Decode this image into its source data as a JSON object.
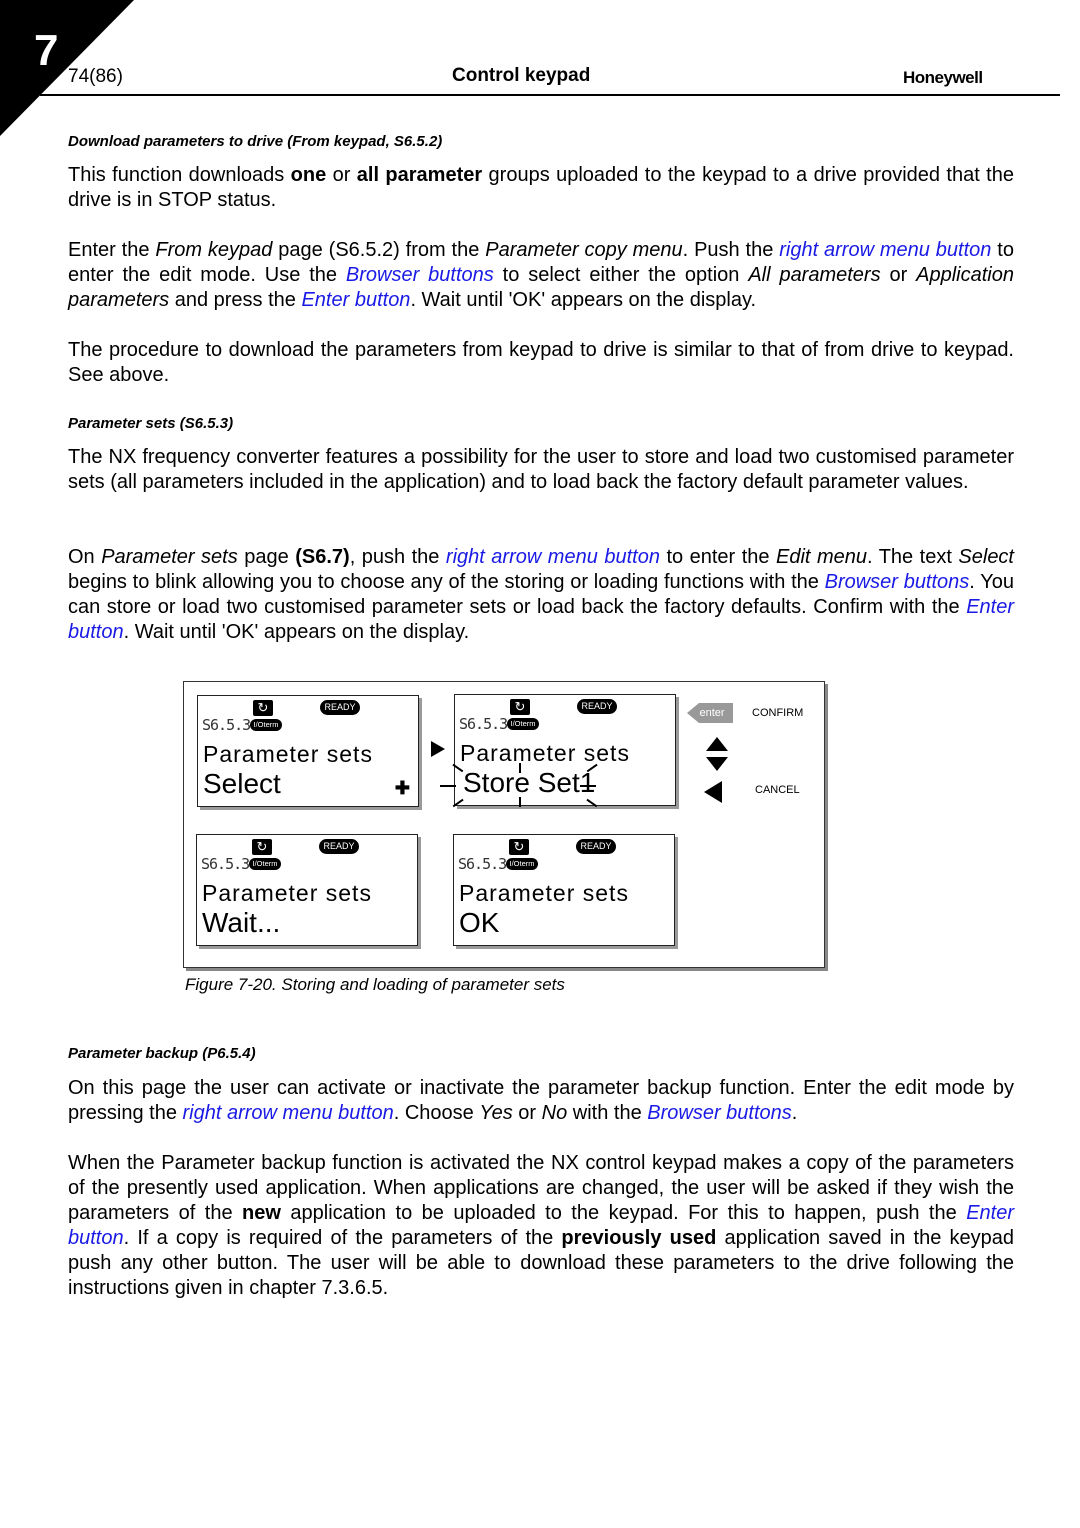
{
  "header": {
    "chapter_number": "7",
    "page_number": "74(86)",
    "title": "Control keypad",
    "brand": "Honeywell"
  },
  "sections": {
    "download": {
      "heading": "Download parameters to drive (From keypad, S6.5.2)",
      "p1": {
        "t1": "This function downloads ",
        "b1": "one",
        "t2": " or ",
        "b2": "all parameter",
        "t3": " groups uploaded to the keypad to a drive provided that the drive is in STOP status."
      },
      "p2": {
        "t1": "Enter the ",
        "i1": "From keypad",
        "t2": " page (S6.5.2) from the ",
        "i2": "Parameter copy menu",
        "t3": ". Push the ",
        "l1": "right arrow menu button",
        "t4": " to enter the edit mode. Use the ",
        "l2": "Browser buttons",
        "t5": " to select either the option ",
        "i3": "All parameters",
        "t6": " or ",
        "i4": "Application parameters",
        "t7": " and press the ",
        "l3": "Enter button",
        "t8": ". Wait until 'OK' appears on the display."
      },
      "p3": "The procedure to download the parameters from keypad to drive is similar to that of from drive to keypad. See above."
    },
    "parameter_sets": {
      "heading": "Parameter sets (S6.5.3)",
      "p1": "The NX frequency converter features a possibility for the user to store and load two customised parameter sets (all parameters included in the application) and to load back the factory default parameter values.",
      "p2": {
        "t1": "On ",
        "i1": "Parameter sets",
        "t2": " page ",
        "b1": "(S6.7)",
        "t3": ", push the ",
        "l1": "right arrow menu button",
        "t4": " to enter the ",
        "i2": "Edit menu",
        "t5": ". The text ",
        "i3": "Select",
        "t6": " begins to blink allowing you to choose any of the storing or loading functions with the ",
        "l2": "Browser buttons",
        "t7": ". You can store or load two customised parameter sets or load back the factory defaults. Confirm with the ",
        "l3": "Enter button",
        "t8": ". Wait until 'OK' appears on the display."
      }
    },
    "backup": {
      "heading": "Parameter backup (P6.5.4)",
      "p1": {
        "t1": "On this page the user can activate or inactivate the parameter backup function. Enter the edit mode by pressing the ",
        "l1": "right arrow menu button",
        "t2": ". Choose ",
        "i1": "Yes",
        "t3": " or ",
        "i2": "No",
        "t4": " with the ",
        "l2": "Browser buttons",
        "t5": "."
      },
      "p2": {
        "t1": "When the Parameter backup function is activated the NX control keypad makes a copy of the parameters of the presently used application. When applications are changed, the user will be asked if they wish the parameters of the ",
        "b1": "new",
        "t2": " application to be uploaded to the keypad. For this to happen, push the ",
        "l1": "Enter button",
        "t3": ". If a copy is required of the parameters of the ",
        "b2": "previously used",
        "t4": " application saved in the keypad push any other button. The user will be able to download these parameters to the drive following the instructions given in chapter 7.3.6.5."
      }
    }
  },
  "figure": {
    "caption": "Figure 7-20. Storing and loading of parameter sets",
    "screens": [
      {
        "status": "READY",
        "code": "S6.5.3",
        "io": "I/Oterm",
        "line1": "Parameter sets",
        "line2": "Select"
      },
      {
        "status": "READY",
        "code": "S6.5.3",
        "io": "I/Oterm",
        "line1": "Parameter sets",
        "line2": "Store Set1"
      },
      {
        "status": "READY",
        "code": "S6.5.3",
        "io": "I/Oterm",
        "line1": "Parameter sets",
        "line2": "Wait..."
      },
      {
        "status": "READY",
        "code": "S6.5.3",
        "io": "I/Oterm",
        "line1": "Parameter sets",
        "line2": "OK"
      }
    ],
    "legend": {
      "enter_key": "enter",
      "confirm": "CONFIRM",
      "cancel": "CANCEL"
    }
  }
}
